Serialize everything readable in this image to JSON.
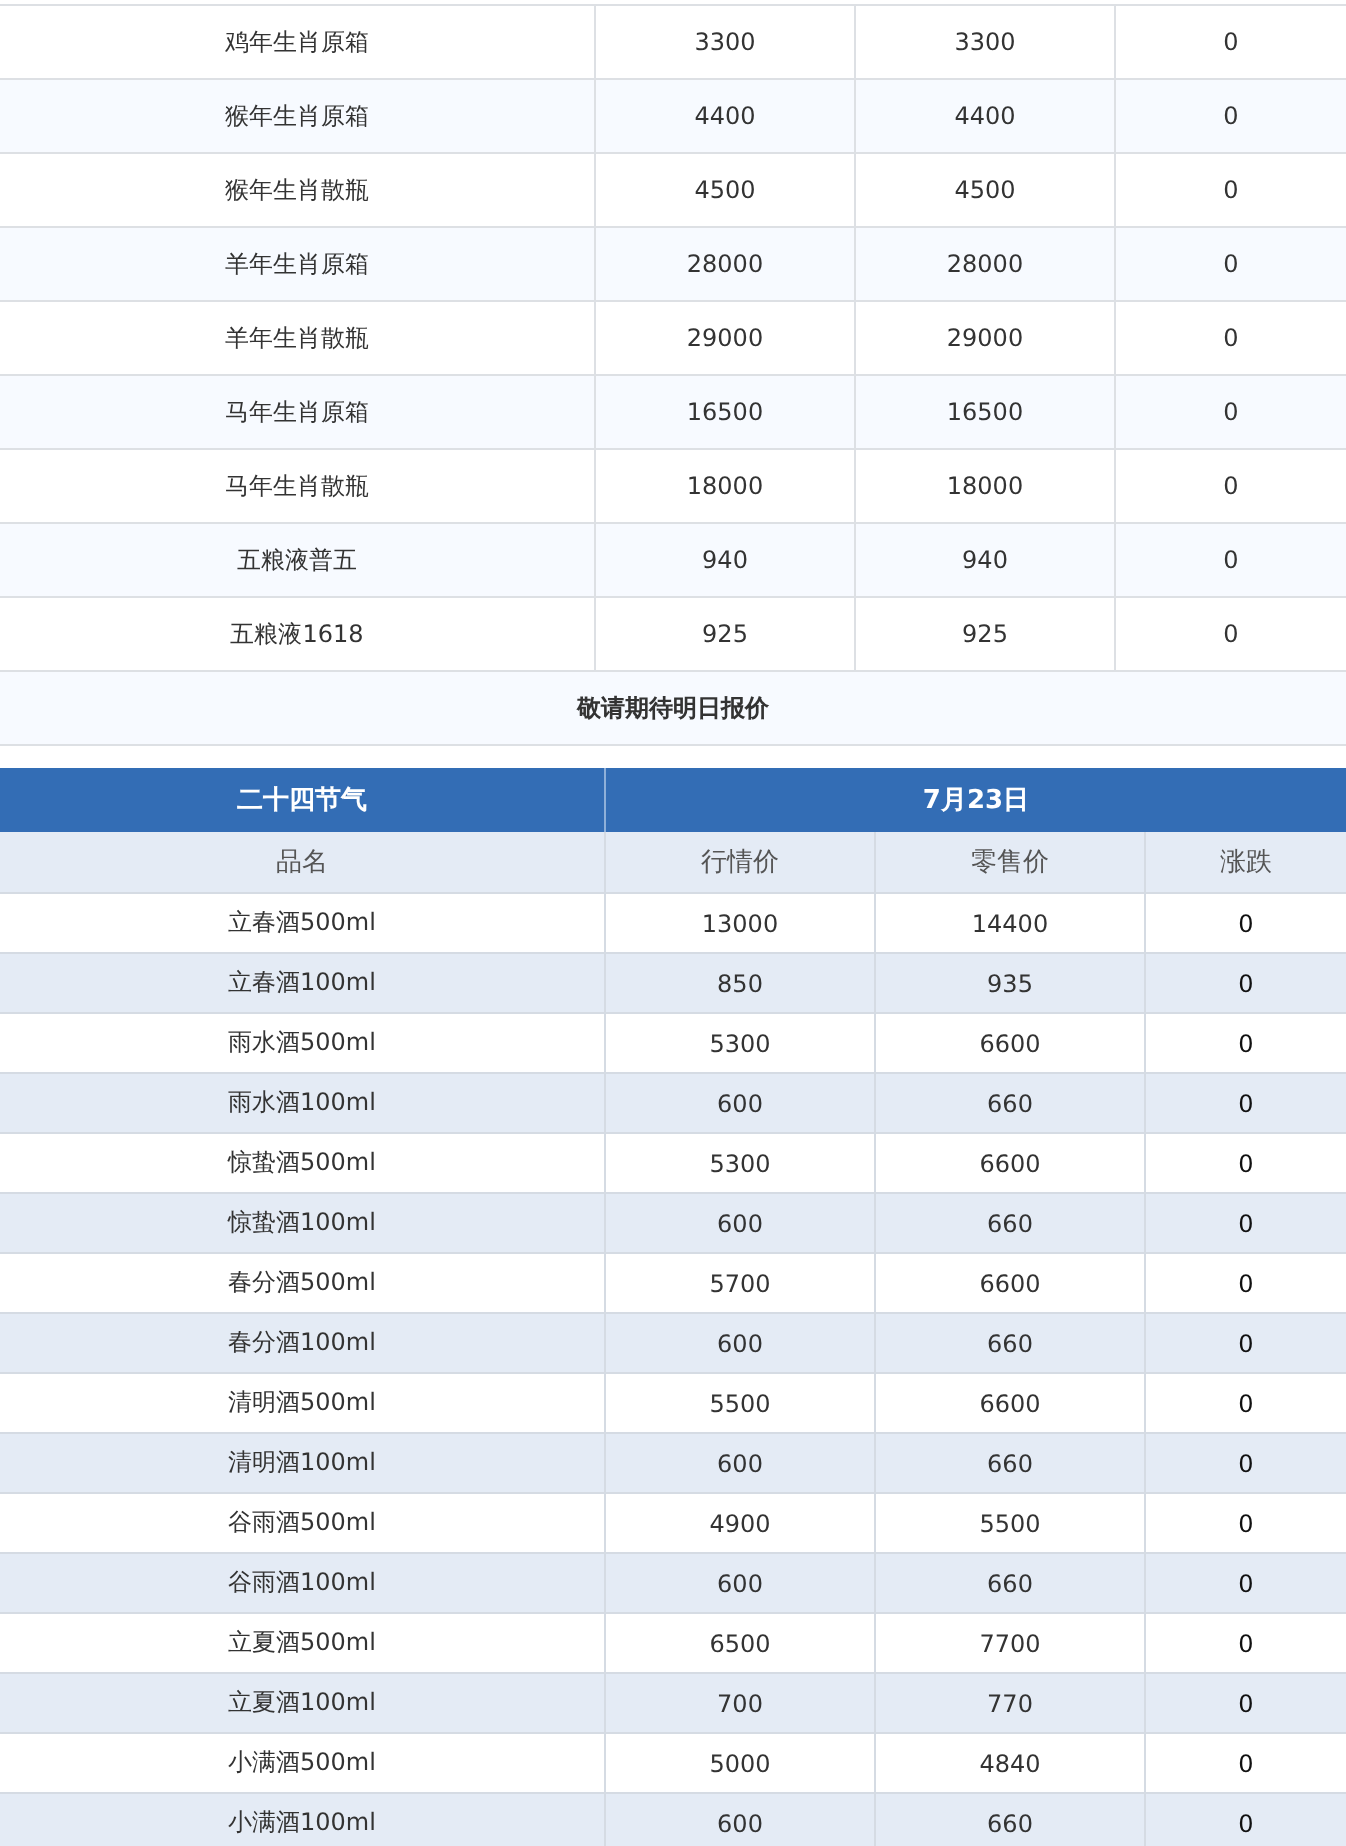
{
  "top_table": {
    "rows": [
      {
        "name": "鸡年生肖原箱",
        "column_2": "3300",
        "column_3": "3300",
        "column_4": "0"
      },
      {
        "name": "猴年生肖原箱",
        "column_2": "4400",
        "column_3": "4400",
        "column_4": "0"
      },
      {
        "name": "猴年生肖散瓶",
        "column_2": "4500",
        "column_3": "4500",
        "column_4": "0"
      },
      {
        "name": "羊年生肖原箱",
        "column_2": "28000",
        "column_3": "28000",
        "column_4": "0"
      },
      {
        "name": "羊年生肖散瓶",
        "column_2": "29000",
        "column_3": "29000",
        "column_4": "0"
      },
      {
        "name": "马年生肖原箱",
        "column_2": "16500",
        "column_3": "16500",
        "column_4": "0"
      },
      {
        "name": "马年生肖散瓶",
        "column_2": "18000",
        "column_3": "18000",
        "column_4": "0"
      },
      {
        "name": "五粮液普五",
        "column_2": "940",
        "column_3": "940",
        "column_4": "0"
      },
      {
        "name": "五粮液1618",
        "column_2": "925",
        "column_3": "925",
        "column_4": "0"
      }
    ],
    "note": "敬请期待明日报价"
  },
  "solar_terms_table": {
    "title": "二十四节气",
    "date": "7月23日",
    "columns": [
      "品名",
      "行情价",
      "零售价",
      "涨跌"
    ],
    "rows": [
      {
        "name": "立春酒500ml",
        "market_price": "13000",
        "retail_price": "14400",
        "change": "0"
      },
      {
        "name": "立春酒100ml",
        "market_price": "850",
        "retail_price": "935",
        "change": "0"
      },
      {
        "name": "雨水酒500ml",
        "market_price": "5300",
        "retail_price": "6600",
        "change": "0"
      },
      {
        "name": "雨水酒100ml",
        "market_price": "600",
        "retail_price": "660",
        "change": "0"
      },
      {
        "name": "惊蛰酒500ml",
        "market_price": "5300",
        "retail_price": "6600",
        "change": "0"
      },
      {
        "name": "惊蛰酒100ml",
        "market_price": "600",
        "retail_price": "660",
        "change": "0"
      },
      {
        "name": "春分酒500ml",
        "market_price": "5700",
        "retail_price": "6600",
        "change": "0"
      },
      {
        "name": "春分酒100ml",
        "market_price": "600",
        "retail_price": "660",
        "change": "0"
      },
      {
        "name": "清明酒500ml",
        "market_price": "5500",
        "retail_price": "6600",
        "change": "0"
      },
      {
        "name": "清明酒100ml",
        "market_price": "600",
        "retail_price": "660",
        "change": "0"
      },
      {
        "name": "谷雨酒500ml",
        "market_price": "4900",
        "retail_price": "5500",
        "change": "0"
      },
      {
        "name": "谷雨酒100ml",
        "market_price": "600",
        "retail_price": "660",
        "change": "0"
      },
      {
        "name": "立夏酒500ml",
        "market_price": "6500",
        "retail_price": "7700",
        "change": "0"
      },
      {
        "name": "立夏酒100ml",
        "market_price": "700",
        "retail_price": "770",
        "change": "0"
      },
      {
        "name": "小满酒500ml",
        "market_price": "5000",
        "retail_price": "4840",
        "change": "0"
      },
      {
        "name": "小满酒100ml",
        "market_price": "600",
        "retail_price": "660",
        "change": "0"
      }
    ]
  }
}
